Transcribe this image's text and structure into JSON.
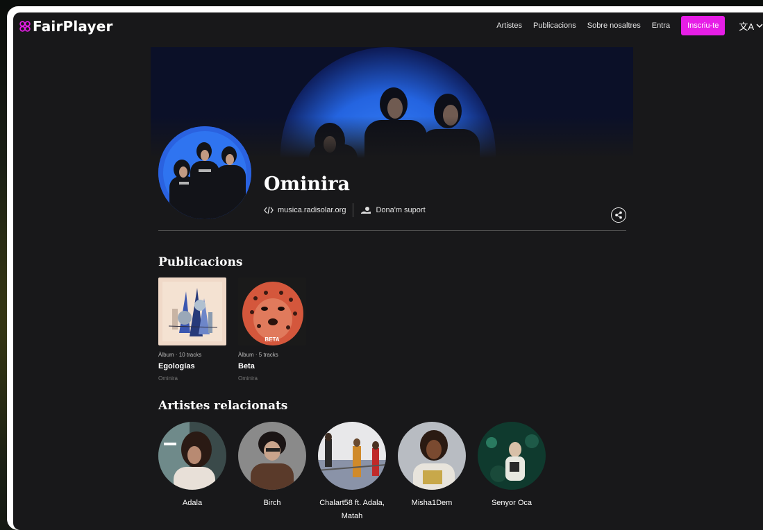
{
  "brand": {
    "name": "FairPlayer",
    "accent": "#e61ee6"
  },
  "nav": {
    "items": [
      "Artistes",
      "Publicacions",
      "Sobre nosaltres",
      "Entra"
    ],
    "signup_label": "Inscriu-te",
    "language_icon": "translate-icon"
  },
  "artist": {
    "name": "Ominira",
    "website": "musica.radisolar.org",
    "support_label": "Dona'm suport"
  },
  "releases_section": {
    "title": "Publicacions",
    "items": [
      {
        "type": "Àlbum · 10 tracks",
        "title": "Egologías",
        "artist": "Ominira"
      },
      {
        "type": "Àlbum · 5 tracks",
        "title": "Beta",
        "artist": "Ominira",
        "cover_text": "BETA"
      }
    ]
  },
  "related_section": {
    "title": "Artistes relacionats",
    "items": [
      {
        "name": "Adala"
      },
      {
        "name": "Birch"
      },
      {
        "name": "Chalart58 ft. Adala, Matah"
      },
      {
        "name": "Misha1Dem"
      },
      {
        "name": "Senyor Oca"
      }
    ]
  }
}
